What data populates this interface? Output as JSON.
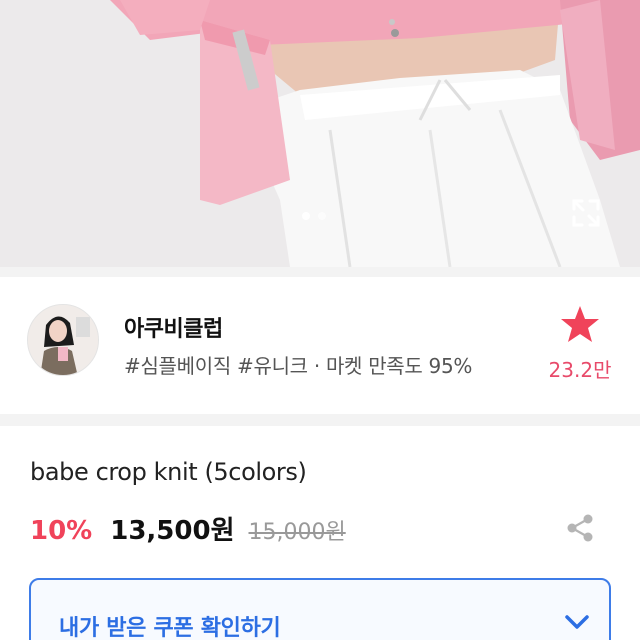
{
  "hero": {
    "image_description_icon": "product-photo",
    "dots": [
      true,
      false
    ],
    "expand_icon": "expand-icon"
  },
  "shop": {
    "name": "아쿠비클럽",
    "tags": "#심플베이직 #유니크 · 마켓 만족도 95%",
    "favorite_icon": "star-icon",
    "favorite_count": "23.2만",
    "accent_color": "#e84a6a"
  },
  "product": {
    "name": "babe crop knit (5colors)",
    "discount": "10%",
    "price": "13,500원",
    "original_price": "15,000원",
    "share_icon": "share-icon",
    "discount_color": "#f0435a"
  },
  "coupon": {
    "label": "내가 받은 쿠폰 확인하기",
    "chevron_icon": "chevron-down-icon",
    "color": "#2c6ee3"
  }
}
